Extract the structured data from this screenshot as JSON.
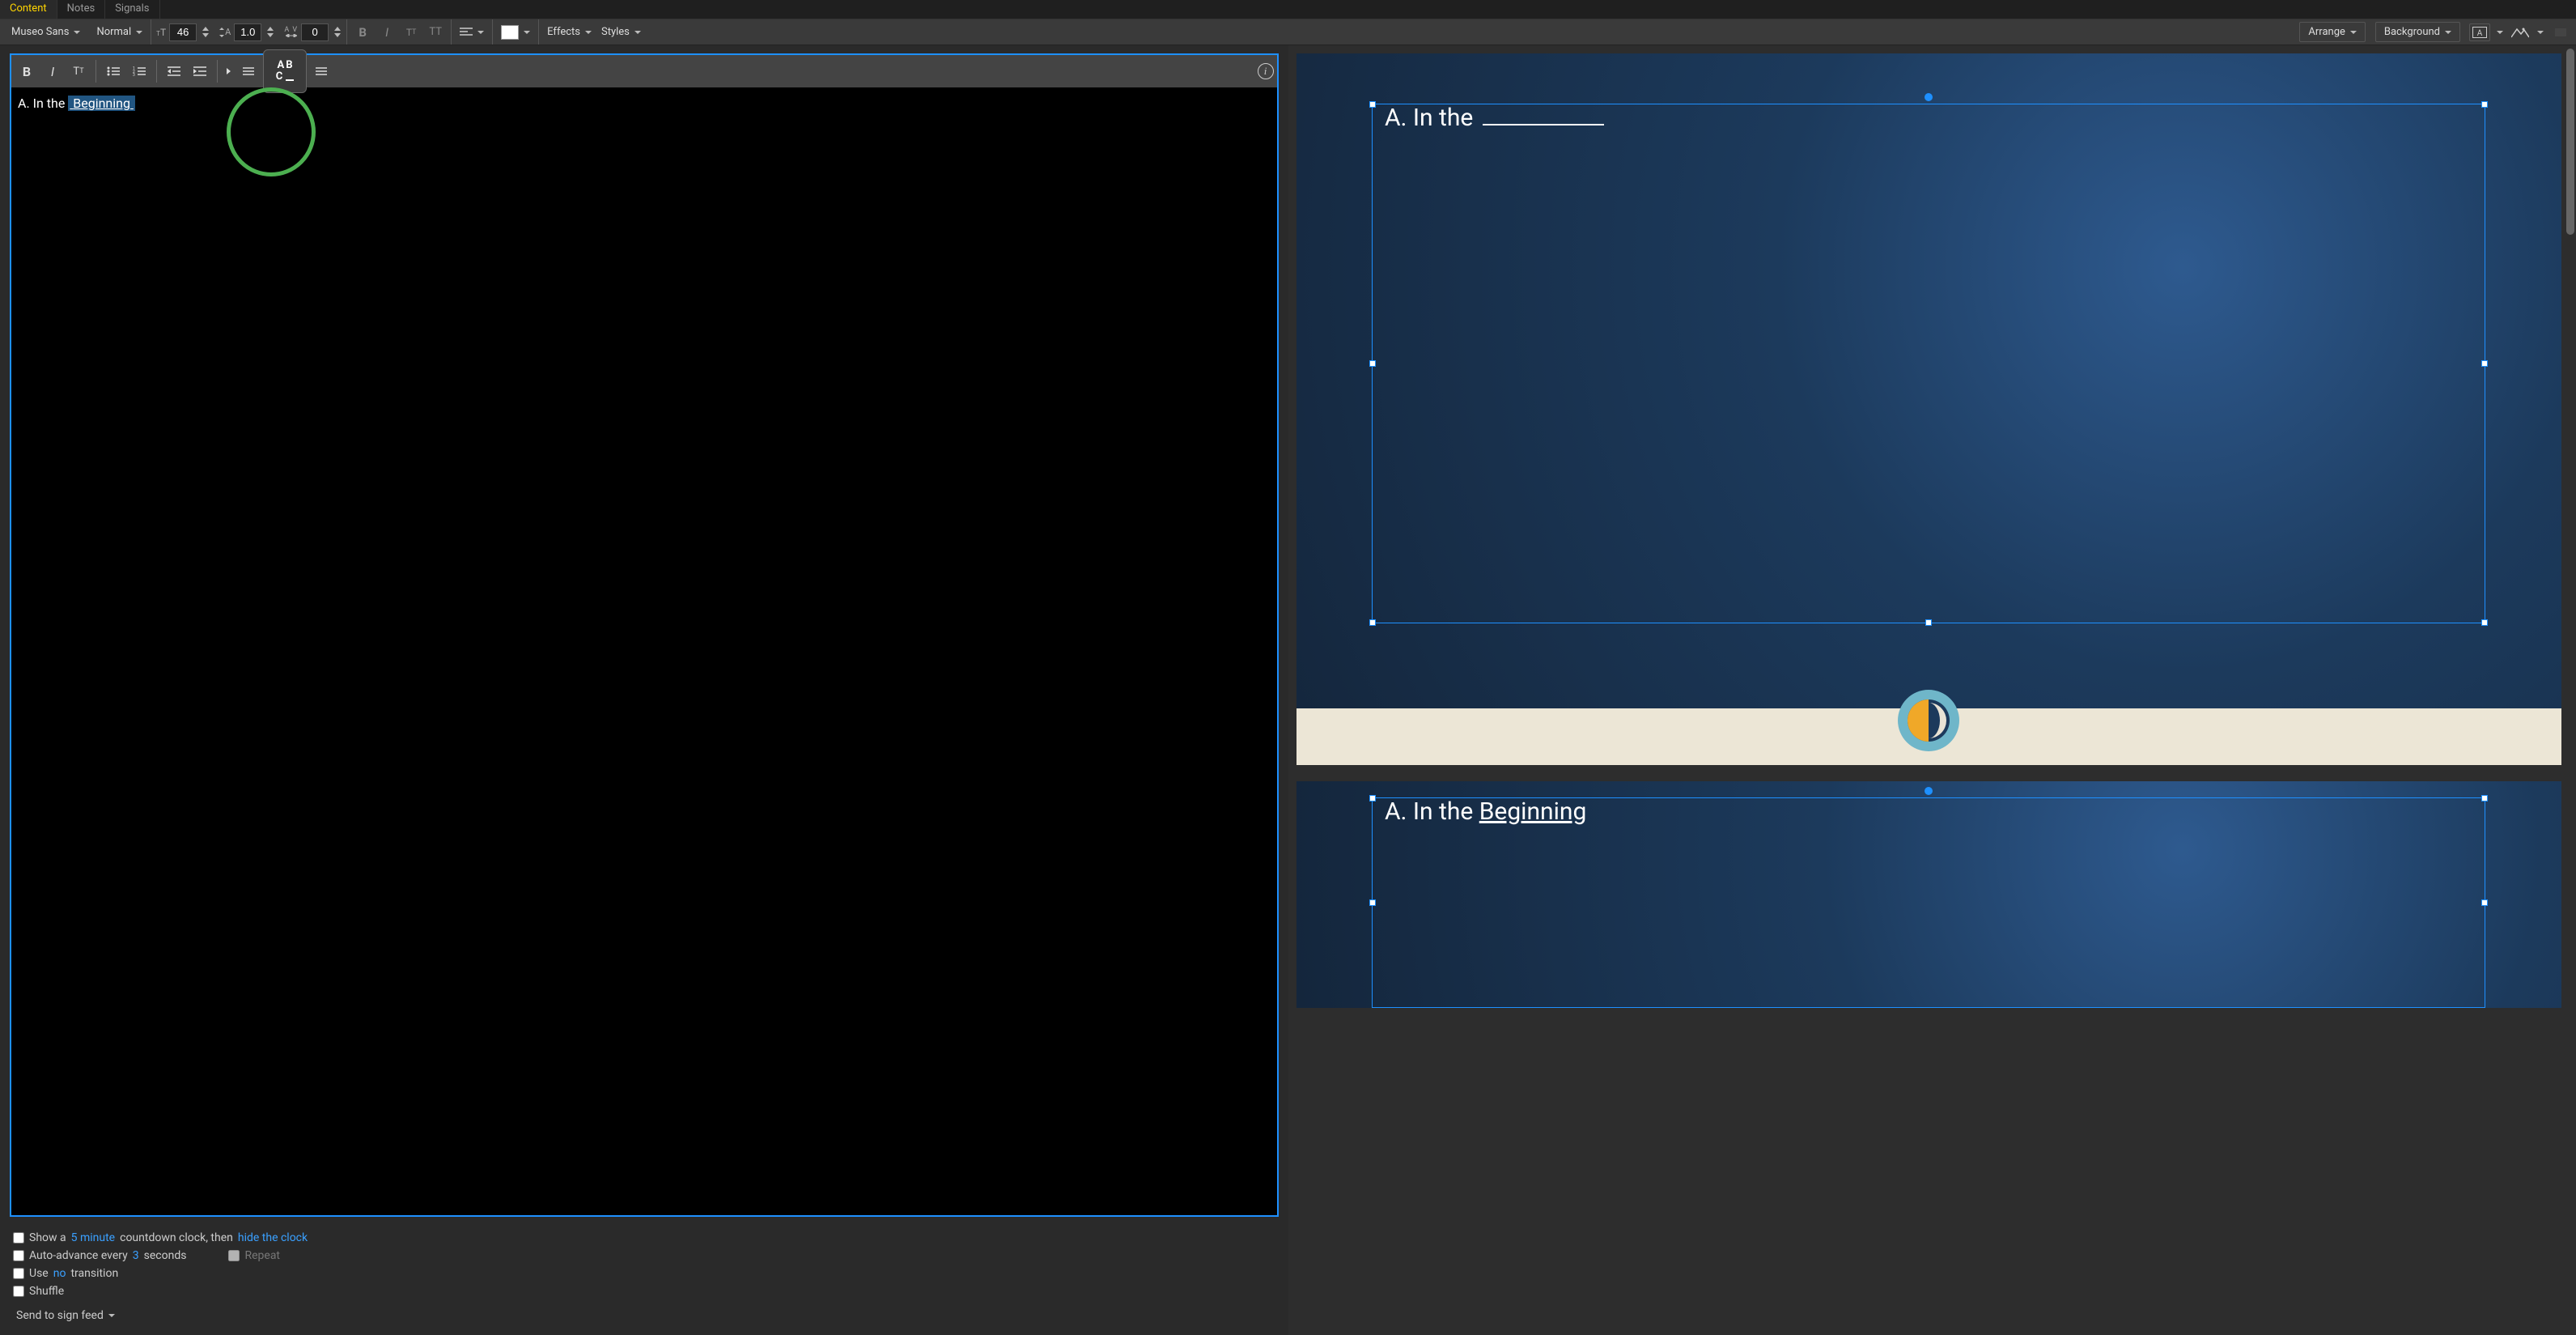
{
  "tabs": {
    "content": "Content",
    "notes": "Notes",
    "signals": "Signals"
  },
  "toolbar": {
    "font": "Museo Sans",
    "weight": "Normal",
    "size": "46",
    "line": "1.0",
    "tracking": "0",
    "effects": "Effects",
    "styles": "Styles",
    "arrange": "Arrange",
    "background": "Background"
  },
  "editor": {
    "typed": "A. In the ",
    "fill": "Beginning"
  },
  "options": {
    "show_a": "Show a",
    "five_min": "5 minute",
    "countdown_then": "countdown clock, then",
    "hide_clock": "hide the clock",
    "auto_adv": "Auto-advance every",
    "auto_val": "3",
    "seconds": "seconds",
    "repeat": "Repeat",
    "use": "Use",
    "no": "no",
    "transition": "transition",
    "shuffle": "Shuffle",
    "send": "Send to sign feed"
  },
  "slide1": {
    "title_pre": "A. In the "
  },
  "slide2": {
    "title_pre": "A. In the ",
    "title_word": "Beginning"
  }
}
